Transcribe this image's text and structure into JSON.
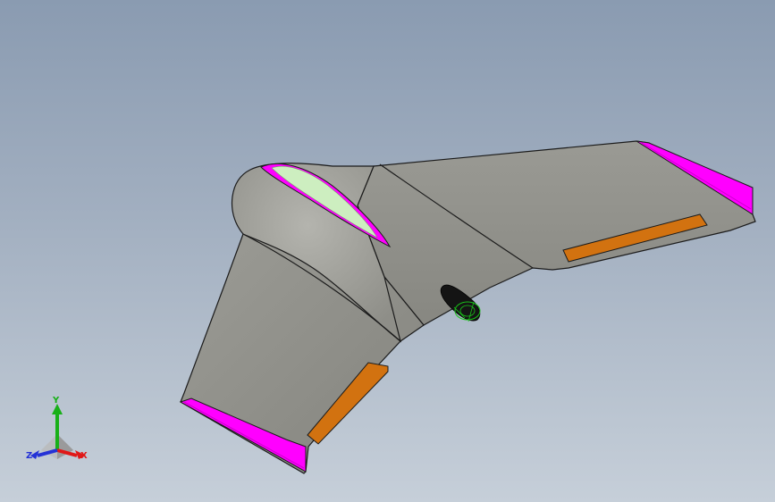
{
  "viewport": {
    "background_top": "#8a9bb1",
    "background_bottom": "#c6cfd9"
  },
  "model": {
    "name": "flying-wing-uav",
    "colors": {
      "body": "#8d8d87",
      "body_light": "#a2a29c",
      "edge": "#1b1b1b",
      "wingtip": "#ff00ff",
      "elevon": "#d27210",
      "canopy": "#cdeec0",
      "motor": "#141414",
      "propeller_accent": "#19c219"
    }
  },
  "triad": {
    "axes": [
      {
        "label": "Y",
        "color": "#18b018",
        "icon": "y-axis-arrow"
      },
      {
        "label": "X",
        "color": "#e01818",
        "icon": "x-axis-arrow"
      },
      {
        "label": "Z",
        "color": "#2432d6",
        "icon": "z-axis-arrow"
      }
    ]
  }
}
